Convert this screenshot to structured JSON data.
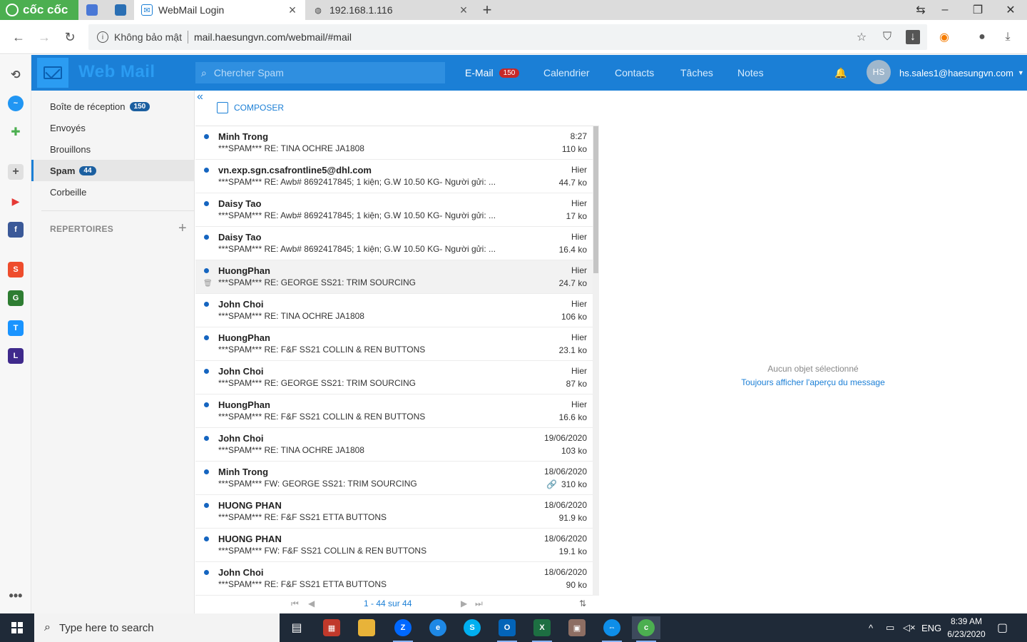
{
  "browser": {
    "brand": "cốc cốc",
    "tabs": [
      {
        "title": "WebMail Login"
      },
      {
        "title": "192.168.1.116"
      }
    ],
    "security_label": "Không bảo mật",
    "url": "mail.haesungvn.com/webmail/#mail"
  },
  "header": {
    "app_title": "Web Mail",
    "search_placeholder": "Chercher Spam",
    "nav": [
      {
        "label": "E-Mail",
        "badge": "150"
      },
      {
        "label": "Calendrier"
      },
      {
        "label": "Contacts"
      },
      {
        "label": "Tâches"
      },
      {
        "label": "Notes"
      }
    ],
    "avatar_initials": "HS",
    "user_email": "hs.sales1@haesungvn.com"
  },
  "folders": {
    "items": [
      {
        "label": "Boîte de réception",
        "badge": "150"
      },
      {
        "label": "Envoyés"
      },
      {
        "label": "Brouillons"
      },
      {
        "label": "Spam",
        "badge": "44"
      },
      {
        "label": "Corbeille"
      }
    ],
    "section_label": "REPERTOIRES"
  },
  "list": {
    "compose_label": "COMPOSER",
    "messages": [
      {
        "from": "Minh Trong",
        "subject": "***SPAM*** RE: TINA OCHRE JA1808",
        "date": "8:27",
        "size": "110 ko"
      },
      {
        "from": "vn.exp.sgn.csafrontline5@dhl.com",
        "subject": "***SPAM*** RE: Awb# 8692417845; 1 kiện; G.W 10.50 KG- Người gửi: ...",
        "date": "Hier",
        "size": "44.7 ko"
      },
      {
        "from": "Daisy Tao",
        "subject": "***SPAM*** RE: Awb# 8692417845; 1 kiện; G.W 10.50 KG- Người gửi: ...",
        "date": "Hier",
        "size": "17 ko"
      },
      {
        "from": "Daisy Tao",
        "subject": "***SPAM*** RE: Awb# 8692417845; 1 kiện; G.W 10.50 KG- Người gửi: ...",
        "date": "Hier",
        "size": "16.4 ko"
      },
      {
        "from": "HuongPhan",
        "subject": "***SPAM*** RE: GEORGE SS21: TRIM SOURCING",
        "date": "Hier",
        "size": "24.7 ko"
      },
      {
        "from": "John Choi",
        "subject": "***SPAM*** RE: TINA OCHRE JA1808",
        "date": "Hier",
        "size": "106 ko"
      },
      {
        "from": "HuongPhan",
        "subject": "***SPAM*** RE: F&F SS21 COLLIN & REN BUTTONS",
        "date": "Hier",
        "size": "23.1 ko"
      },
      {
        "from": "John Choi",
        "subject": "***SPAM*** RE: GEORGE SS21: TRIM SOURCING",
        "date": "Hier",
        "size": "87 ko"
      },
      {
        "from": "HuongPhan",
        "subject": "***SPAM*** RE: F&F SS21 COLLIN & REN BUTTONS",
        "date": "Hier",
        "size": "16.6 ko"
      },
      {
        "from": "John Choi",
        "subject": "***SPAM*** RE: TINA OCHRE JA1808",
        "date": "19/06/2020",
        "size": "103 ko"
      },
      {
        "from": "Minh Trong",
        "subject": "***SPAM*** FW: GEORGE SS21: TRIM SOURCING",
        "date": "18/06/2020",
        "size": "310 ko"
      },
      {
        "from": "HUONG PHAN",
        "subject": "***SPAM*** RE: F&F SS21 ETTA BUTTONS",
        "date": "18/06/2020",
        "size": "91.9 ko"
      },
      {
        "from": "HUONG PHAN",
        "subject": "***SPAM*** FW: F&F SS21 COLLIN & REN BUTTONS",
        "date": "18/06/2020",
        "size": "19.1 ko"
      },
      {
        "from": "John Choi",
        "subject": "***SPAM*** RE: F&F SS21 ETTA BUTTONS",
        "date": "18/06/2020",
        "size": "90 ko"
      }
    ],
    "pagination": "1 - 44 sur 44"
  },
  "preview": {
    "empty_label": "Aucun objet sélectionné",
    "link_label": "Toujours afficher l'aperçu du message"
  },
  "taskbar": {
    "search_placeholder": "Type here to search",
    "lang": "ENG",
    "time": "8:39 AM",
    "date": "6/23/2020"
  }
}
